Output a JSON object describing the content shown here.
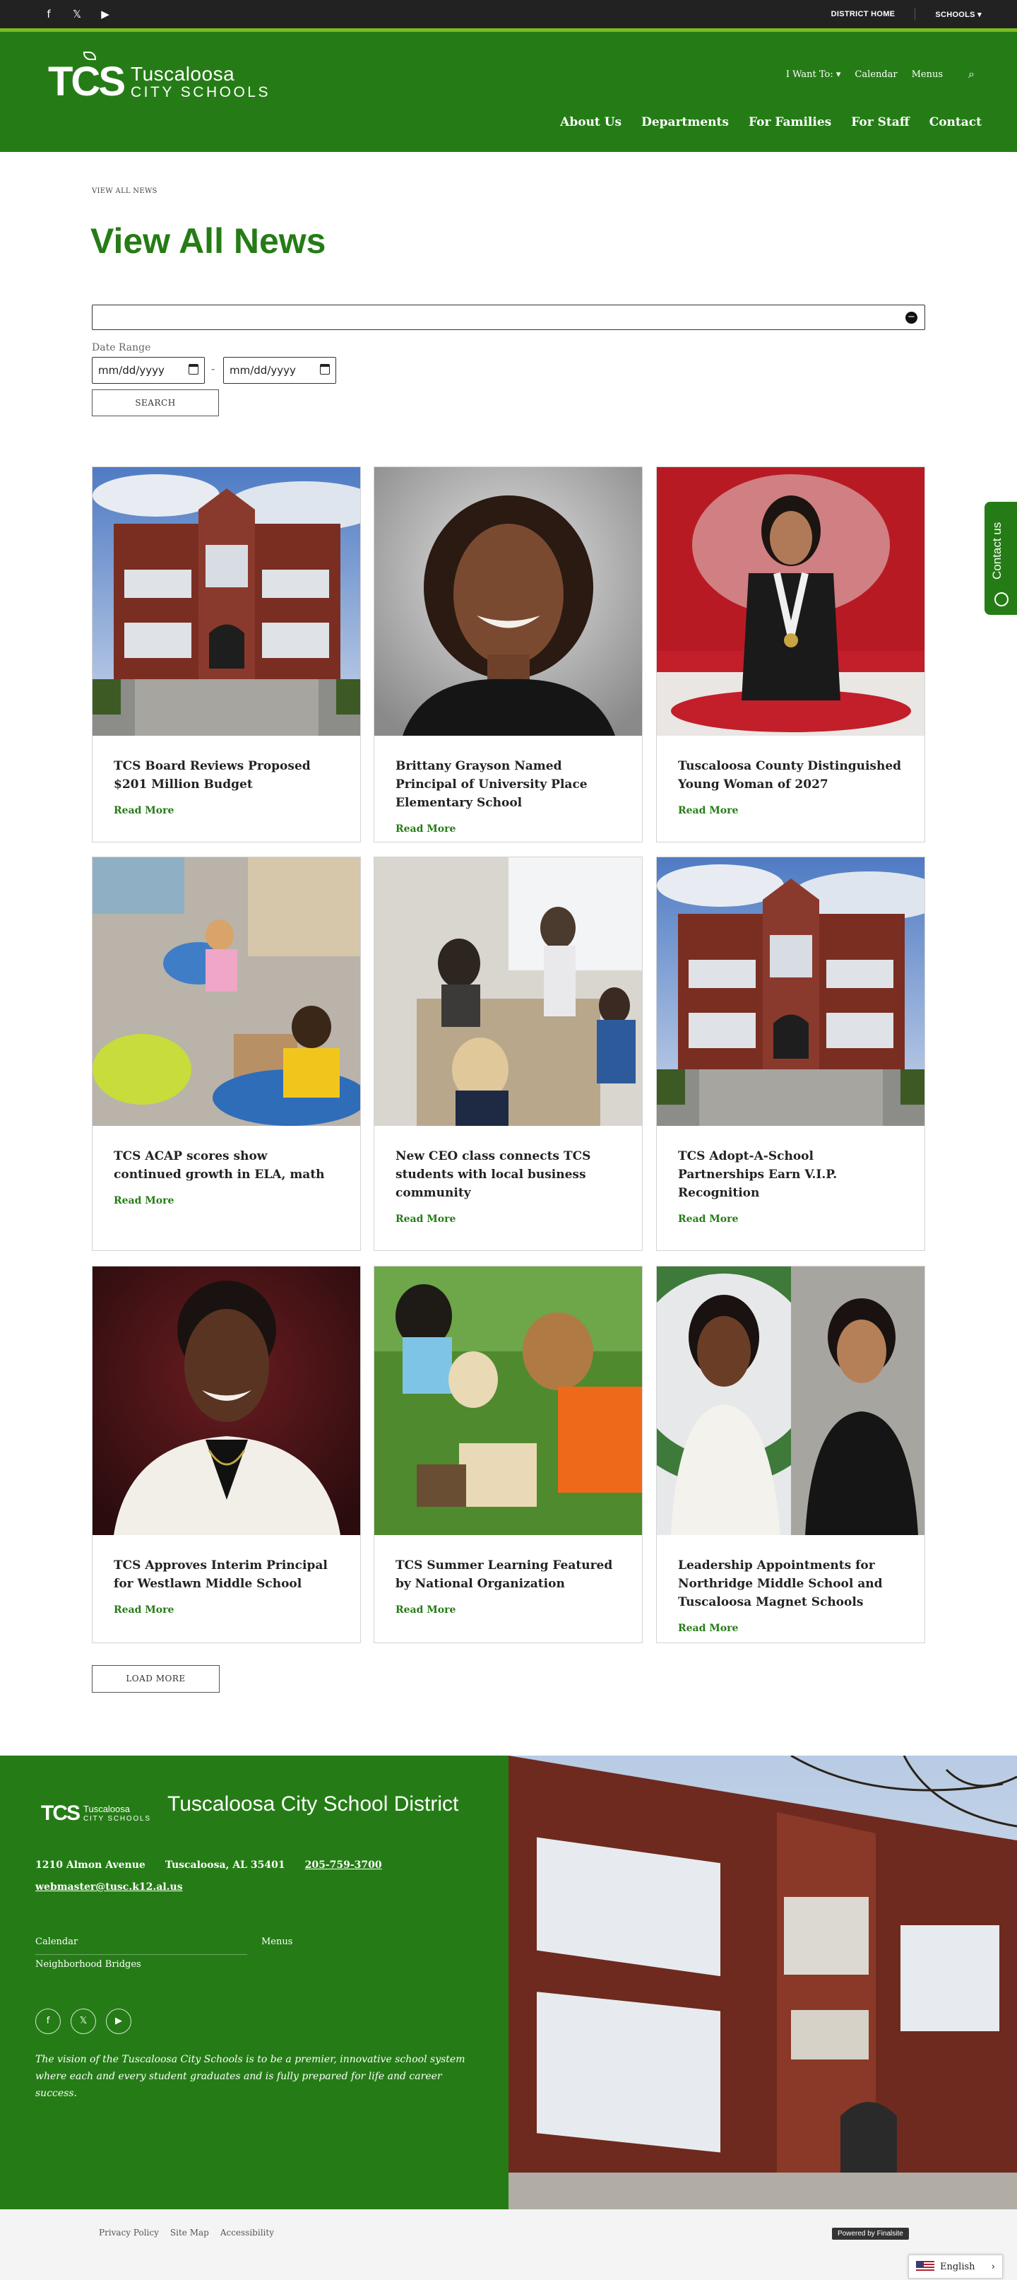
{
  "utility_bar": {
    "social_icons": [
      "facebook-icon",
      "twitter-icon",
      "youtube-icon"
    ],
    "district_home": "DISTRICT HOME",
    "schools": "SCHOOLS ▾"
  },
  "header": {
    "logo_mark": "TCS",
    "logo_line1": "Tuscaloosa",
    "logo_line2": "CITY SCHOOLS",
    "util_links": {
      "i_want_to": "I Want To: ▾",
      "calendar": "Calendar",
      "menus": "Menus"
    },
    "nav": {
      "about": "About Us",
      "departments": "Departments",
      "families": "For Families",
      "staff": "For Staff",
      "contact": "Contact"
    }
  },
  "page": {
    "breadcrumb": "VIEW ALL NEWS",
    "title": "View All News",
    "date_range_label": "Date Range",
    "date_from_placeholder": "mm/dd/yyyy",
    "date_to_placeholder": "mm/dd/yyyy",
    "search_button": "SEARCH",
    "load_more": "LOAD MORE"
  },
  "news": [
    {
      "headline": "TCS Board Reviews Proposed $201 Million Budget",
      "read_more": "Read More",
      "photo": "school-building"
    },
    {
      "headline": "Brittany Grayson Named Principal of University Place Elementary School",
      "read_more": "Read More",
      "photo": "portrait-woman"
    },
    {
      "headline": "Tuscaloosa County Distinguished Young Woman of 2027",
      "read_more": "Read More",
      "photo": "medal-student"
    },
    {
      "headline": "TCS ACAP scores show continued growth in ELA, math",
      "read_more": "Read More",
      "photo": "kids-reading"
    },
    {
      "headline": "New CEO class connects TCS students with local business community",
      "read_more": "Read More",
      "photo": "classroom-meeting"
    },
    {
      "headline": "TCS Adopt-A-School Partnerships Earn V.I.P. Recognition",
      "read_more": "Read More",
      "photo": "school-building"
    },
    {
      "headline": "TCS Approves Interim Principal for Westlawn Middle School",
      "read_more": "Read More",
      "photo": "portrait-principal"
    },
    {
      "headline": "TCS Summer Learning Featured by National Organization",
      "read_more": "Read More",
      "photo": "kids-outdoors"
    },
    {
      "headline": "Leadership Appointments for Northridge Middle School and Tuscaloosa Magnet Schools",
      "read_more": "Read More",
      "photo": "two-portraits"
    }
  ],
  "contact_tab": "Contact us",
  "footer": {
    "logo_mark": "TCS",
    "logo_line1": "Tuscaloosa",
    "logo_line2": "CITY SCHOOLS",
    "district_name": "Tuscaloosa City School District",
    "street": "1210 Almon Avenue",
    "city": "Tuscaloosa, AL  35401",
    "phone": "205-759-3700",
    "email": "webmaster@tusc.k12.al.us",
    "links": {
      "calendar": "Calendar",
      "menus": "Menus",
      "bridges": "Neighborhood Bridges"
    },
    "vision": "The vision of the Tuscaloosa City Schools is to be a premier, innovative school system where each and every student graduates and is fully prepared for life and career success."
  },
  "bottom_bar": {
    "privacy": "Privacy Policy",
    "sitemap": "Site Map",
    "accessibility": "Accessibility",
    "powered_by": "Powered by Finalsite",
    "language": "English"
  },
  "colors": {
    "brand_green": "#257c16",
    "accent_green": "#7dbb23",
    "dark": "#222222"
  }
}
